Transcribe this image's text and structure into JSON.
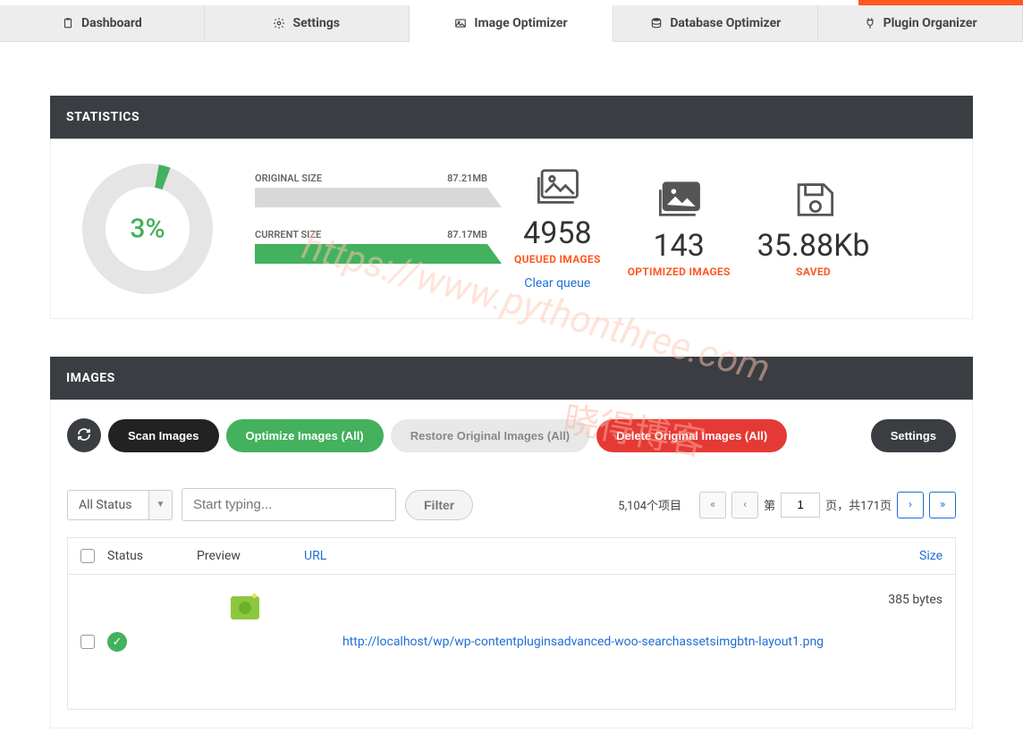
{
  "tabs": {
    "dashboard": "Dashboard",
    "settings": "Settings",
    "image_optimizer": "Image Optimizer",
    "database_optimizer": "Database Optimizer",
    "plugin_organizer": "Plugin Organizer"
  },
  "stats": {
    "title": "STATISTICS",
    "percent": "3%",
    "original_label": "ORIGINAL SIZE",
    "original_value": "87.21MB",
    "current_label": "CURRENT SIZE",
    "current_value": "87.17MB",
    "queued_num": "4958",
    "queued_label": "QUEUED IMAGES",
    "optimized_num": "143",
    "optimized_label": "OPTIMIZED IMAGES",
    "saved_num": "35.88Kb",
    "saved_label": "SAVED",
    "clear_queue": "Clear queue"
  },
  "images": {
    "title": "IMAGES",
    "scan": "Scan Images",
    "optimize": "Optimize Images (All)",
    "restore": "Restore Original Images (All)",
    "delete": "Delete Original Images (All)",
    "settings_btn": "Settings",
    "status_filter": "All Status",
    "search_placeholder": "Start typing...",
    "filter_btn": "Filter",
    "item_count": "5,104个项目",
    "page_prefix": "第",
    "page_value": "1",
    "page_suffix": "页，共171页",
    "col_status": "Status",
    "col_preview": "Preview",
    "col_url": "URL",
    "col_size": "Size",
    "row1_url": "http://localhost/wp/wp-contentpluginsadvanced-woo-searchassetsimgbtn-layout1.png",
    "row1_size": "385 bytes"
  },
  "watermark1": "https://www.pythonthree.com",
  "watermark2": "晓得博客"
}
